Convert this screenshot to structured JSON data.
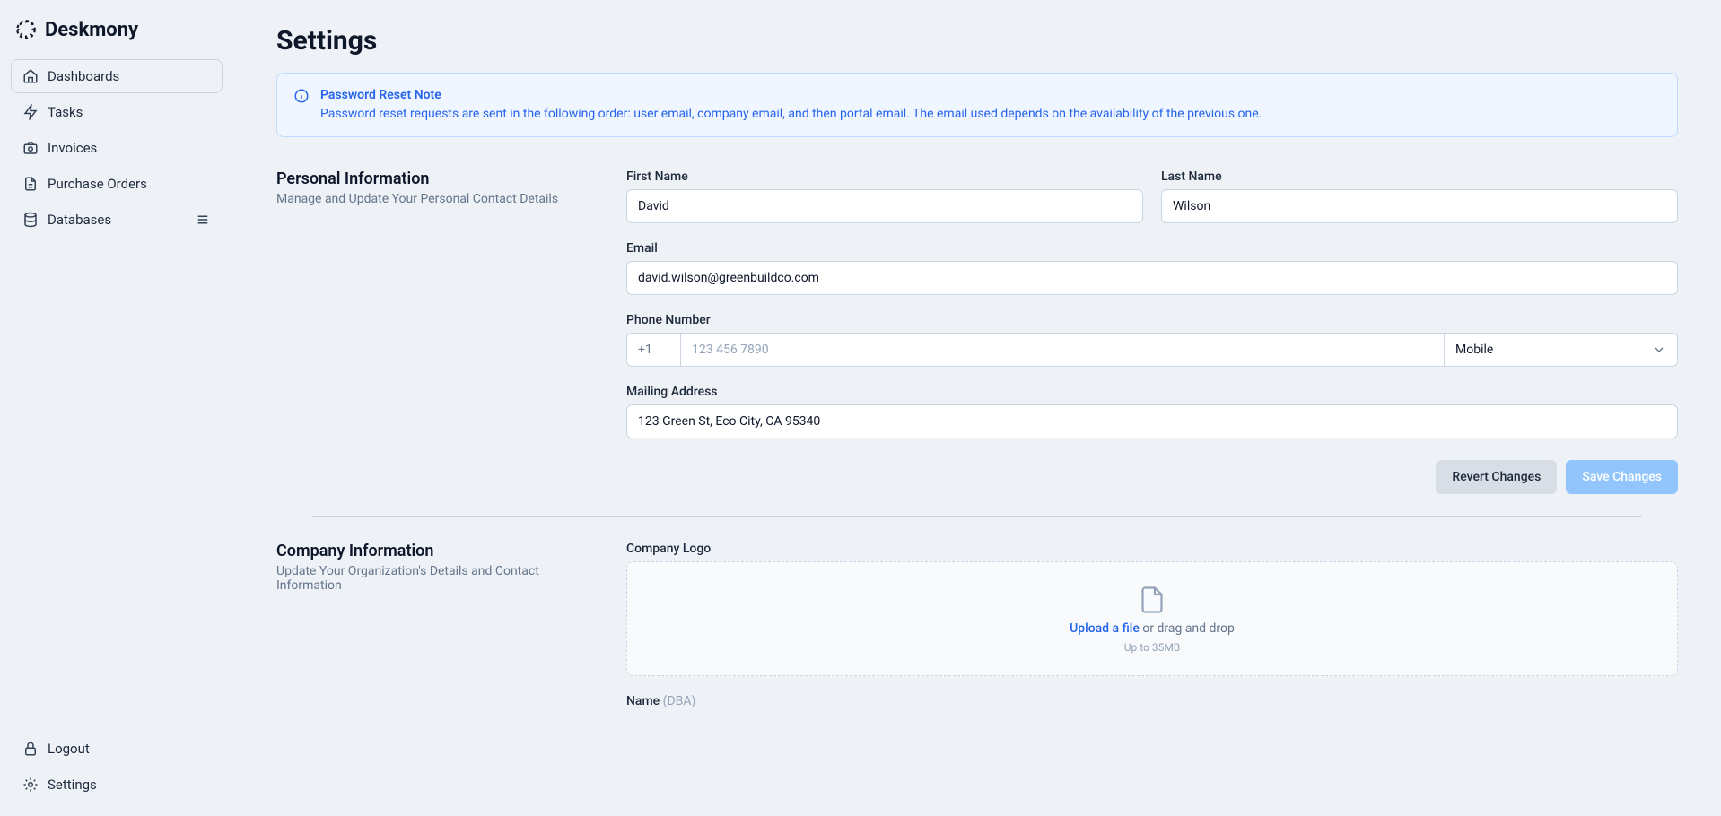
{
  "brand": {
    "name": "Deskmony"
  },
  "sidebar": {
    "items": [
      {
        "label": "Dashboards"
      },
      {
        "label": "Tasks"
      },
      {
        "label": "Invoices"
      },
      {
        "label": "Purchase Orders"
      },
      {
        "label": "Databases"
      }
    ],
    "footer": {
      "logout": "Logout",
      "settings": "Settings"
    }
  },
  "page": {
    "title": "Settings"
  },
  "alert": {
    "title": "Password Reset Note",
    "body": "Password reset requests are sent in the following order: user email, company email, and then portal email. The email used depends on the availability of the previous one."
  },
  "personal": {
    "heading": "Personal Information",
    "sub": "Manage and Update Your Personal Contact Details",
    "labels": {
      "first_name": "First Name",
      "last_name": "Last Name",
      "email": "Email",
      "phone": "Phone Number",
      "mailing": "Mailing Address"
    },
    "values": {
      "first_name": "David",
      "last_name": "Wilson",
      "email": "david.wilson@greenbuildco.com",
      "phone_prefix": "+1",
      "phone_placeholder": "123 456 7890",
      "phone_value": "",
      "phone_type": "Mobile",
      "mailing": "123 Green St, Eco City, CA 95340"
    },
    "actions": {
      "revert": "Revert Changes",
      "save": "Save Changes"
    }
  },
  "company": {
    "heading": "Company Information",
    "sub": "Update Your Organization's Details and Contact Information",
    "labels": {
      "logo": "Company Logo",
      "name": "Name",
      "name_suffix": "(DBA)"
    },
    "upload": {
      "link": "Upload a file",
      "rest": " or drag and drop",
      "sub": "Up to 35MB"
    }
  }
}
